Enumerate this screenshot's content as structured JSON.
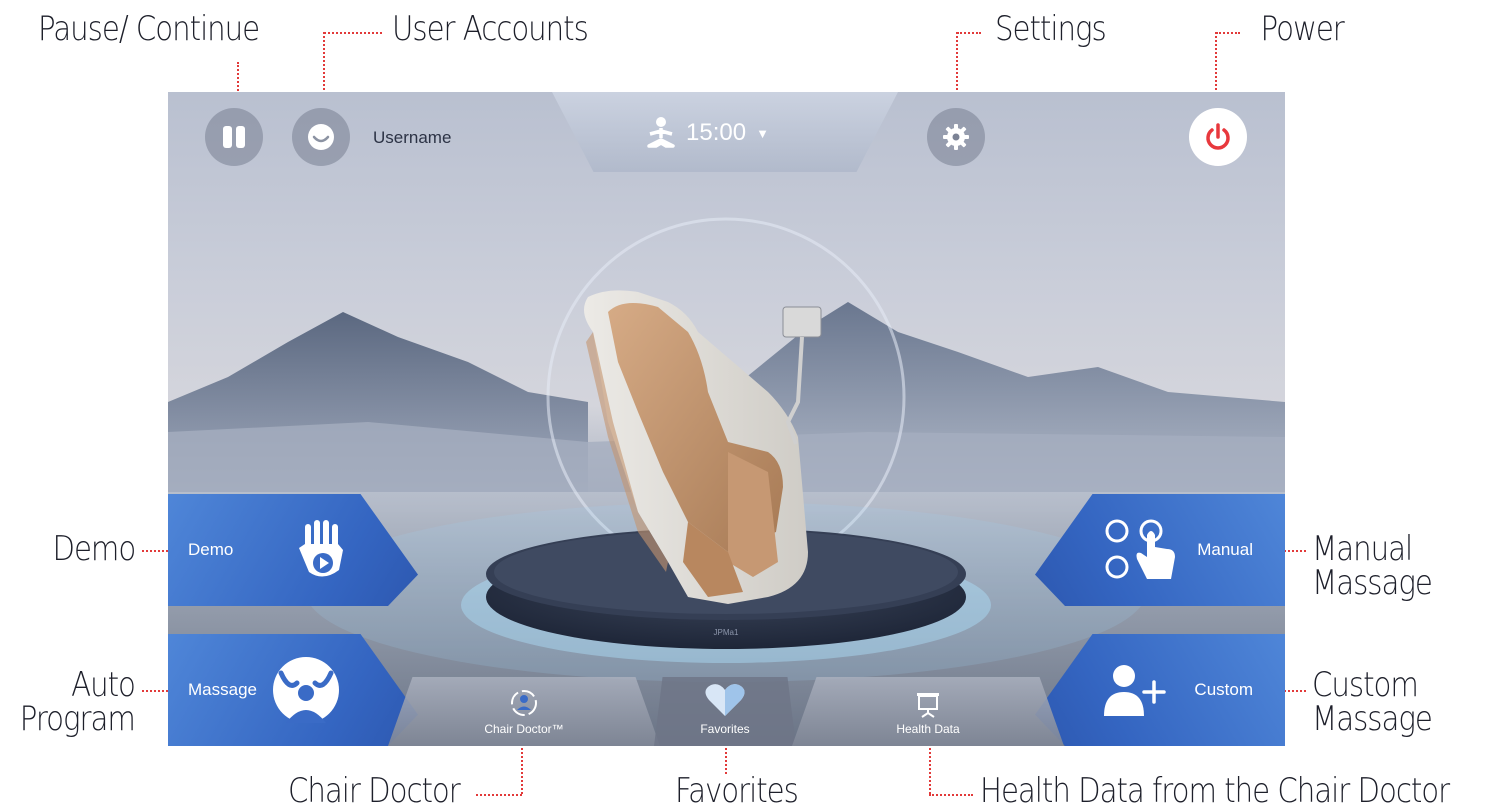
{
  "callouts": {
    "pause_continue": "Pause/ Continue",
    "user_accounts": "User Accounts",
    "settings": "Settings",
    "power": "Power",
    "demo": "Demo",
    "auto_program_l1": "Auto",
    "auto_program_l2": "Program",
    "manual_massage_l1": "Manual",
    "manual_massage_l2": "Massage",
    "custom_massage_l1": "Custom",
    "custom_massage_l2": "Massage",
    "chair_doctor": "Chair Doctor",
    "favorites": "Favorites",
    "health_data": "Health Data from the Chair Doctor"
  },
  "screen": {
    "username": "Username",
    "timer": "15:00",
    "base_text": "JPMa1",
    "left_buttons": [
      {
        "label": "Demo",
        "icon": "hand-play-icon"
      },
      {
        "label": "Massage",
        "icon": "massage-person-icon"
      }
    ],
    "right_buttons": [
      {
        "label": "Manual",
        "icon": "manual-touch-icon"
      },
      {
        "label": "Custom",
        "icon": "add-user-icon"
      }
    ],
    "bottom_tabs": [
      {
        "label": "Chair Doctor™",
        "icon": "chair-doctor-icon"
      },
      {
        "label": "Favorites",
        "icon": "heart-icon"
      },
      {
        "label": "Health Data",
        "icon": "presentation-board-icon"
      }
    ]
  },
  "colors": {
    "callout_line": "#e23a3a",
    "button_blue": "#3465c1",
    "power_red": "#e8383d"
  }
}
